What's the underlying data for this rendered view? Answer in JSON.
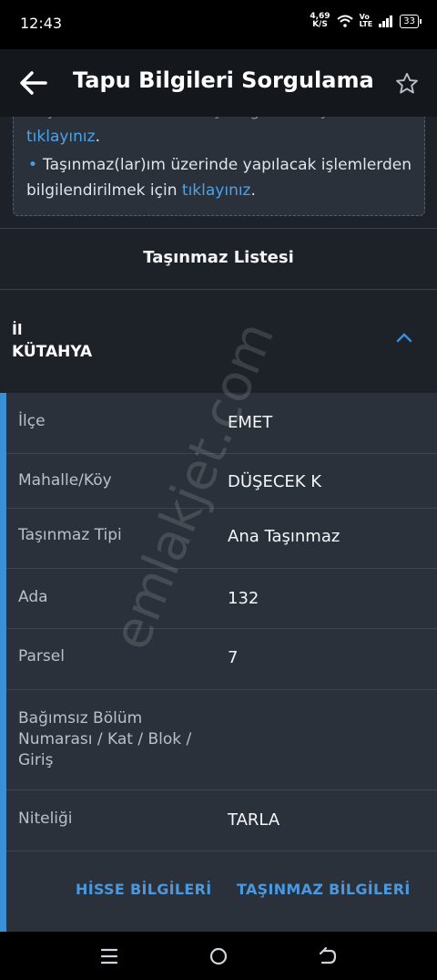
{
  "status_bar": {
    "time": "12:43",
    "net_speed": "4,69",
    "net_unit": "K/S",
    "volte_top": "Vo",
    "volte_bottom": "LTE",
    "battery": "33"
  },
  "header": {
    "title": "Tapu Bilgileri Sorgulama",
    "back_icon": "arrow-left-icon",
    "favorite_icon": "star-outline-icon"
  },
  "info": {
    "cut_line": "başvurularınıza ait sonuçları görmek için",
    "link1": "tıklayınız",
    "link1_suffix": ".",
    "bullet2_text": "Taşınmaz(lar)ım üzerinde yapılacak işlemlerden",
    "bullet2_line2": "bilgilendirilmek için",
    "link2": "tıklayınız",
    "link2_suffix": "."
  },
  "list_title": "Taşınmaz Listesi",
  "il": {
    "label": "İl",
    "value": "KÜTAHYA"
  },
  "rows": [
    {
      "label": "İlçe",
      "value": "EMET"
    },
    {
      "label": "Mahalle/Köy",
      "value": "DÜŞECEK K"
    },
    {
      "label": "Taşınmaz Tipi",
      "value": "Ana Taşınmaz"
    },
    {
      "label": "Ada",
      "value": "132"
    },
    {
      "label": "Parsel",
      "value": "7"
    },
    {
      "label_lines": [
        "Bağımsız Bölüm",
        "Numarası / Kat / Blok /",
        "Giriş"
      ],
      "value": ""
    },
    {
      "label": "Niteliği",
      "value": "TARLA"
    }
  ],
  "actions": {
    "hisse": "HİSSE BİLGİLERİ",
    "tasinmaz": "TAŞINMAZ BİLGİLERİ"
  },
  "watermark": "emlakjet.com",
  "colors": {
    "accent": "#3a8fd9",
    "link": "#4aa3ea",
    "background": "#1d2229",
    "card": "#2b313a"
  }
}
